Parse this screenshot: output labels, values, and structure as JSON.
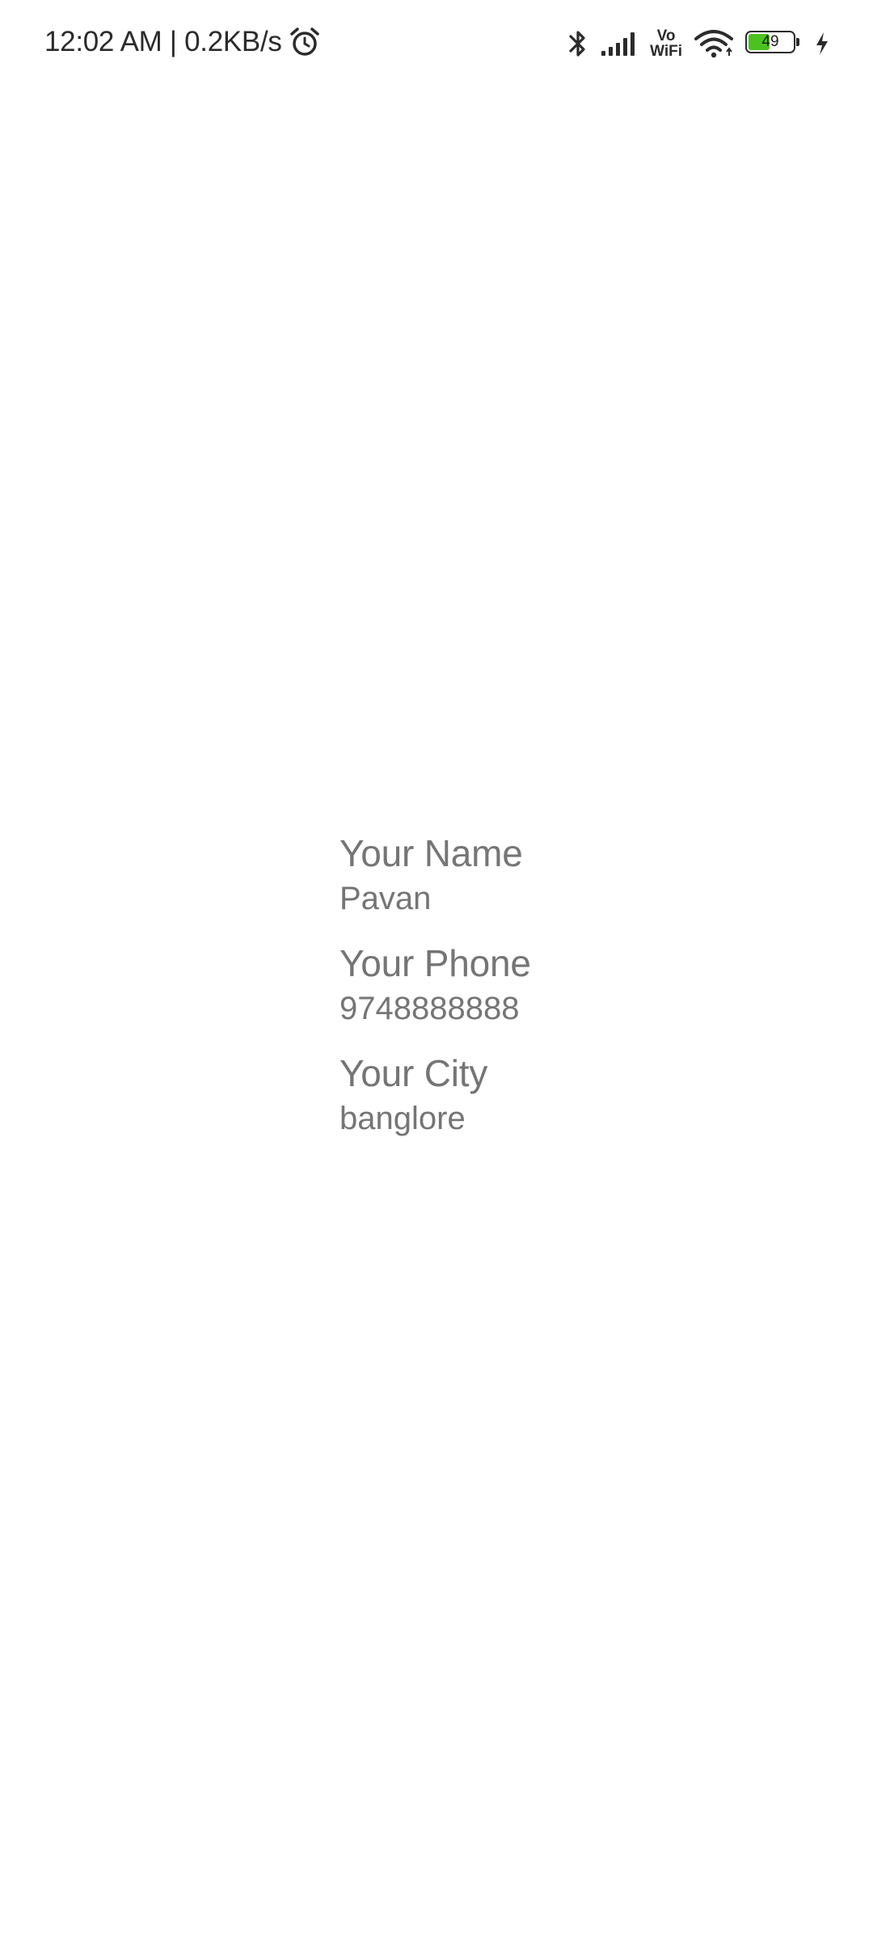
{
  "status_bar": {
    "time_speed": "12:02 AM | 0.2KB/s",
    "alarm_icon": "alarm-clock-icon",
    "bluetooth_icon": "bluetooth-icon",
    "signal_icon": "cellular-signal-icon",
    "vowifi_top": "Vo",
    "vowifi_bottom": "WiFi",
    "wifi_icon": "wifi-icon",
    "battery_level": "49",
    "battery_fraction": 0.49,
    "battery_color": "#4cc21f",
    "charging_icon": "charging-bolt-icon"
  },
  "profile": {
    "name_label": "Your Name",
    "name_value": "Pavan",
    "phone_label": "Your Phone",
    "phone_value": "9748888888",
    "city_label": "Your City",
    "city_value": "banglore"
  }
}
